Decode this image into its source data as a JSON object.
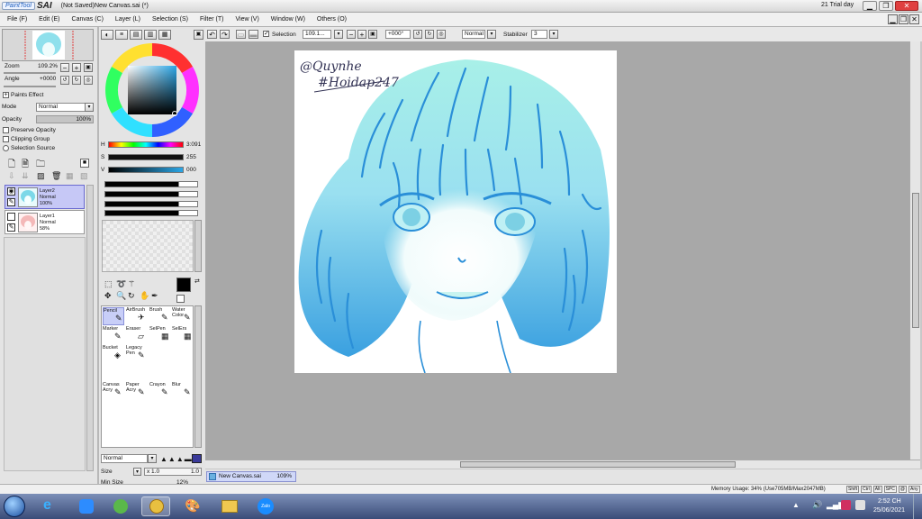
{
  "titlebar": {
    "logo_small": "PaintTool",
    "logo_big": "SAI",
    "title": "(Not Saved)New Canvas.sai (*)",
    "trial": "21 Trial day",
    "minimize": "▁",
    "restore": "❐",
    "close": "✕"
  },
  "menu": [
    "File (F)",
    "Edit (E)",
    "Canvas (C)",
    "Layer (L)",
    "Selection (S)",
    "Filter (T)",
    "View (V)",
    "Window (W)",
    "Others (O)"
  ],
  "toolbar": {
    "selection_label": "Selection",
    "zoom_value": "109.1...",
    "rotation_value": "+000°",
    "mode_value": "Normal",
    "stabilizer_label": "Stabilizer",
    "stabilizer_value": "3"
  },
  "navigator": {
    "zoom_label": "Zoom",
    "zoom_value": "109.2%",
    "angle_label": "Angle",
    "angle_value": "+0000"
  },
  "layer_props": {
    "paints_effect": "Paints Effect",
    "mode_label": "Mode",
    "mode_value": "Normal",
    "opacity_label": "Opacity",
    "opacity_value": "100%",
    "preserve_opacity": "Preserve Opacity",
    "clipping_group": "Clipping Group",
    "selection_source": "Selection Source"
  },
  "layers": [
    {
      "name": "Layer2",
      "mode": "Normal",
      "opacity": "100%",
      "selected": true
    },
    {
      "name": "Layer1",
      "mode": "Normal",
      "opacity": "58%",
      "selected": false
    }
  ],
  "color": {
    "h_label": "H",
    "h_value": "3:091",
    "s_label": "S",
    "s_value": "255",
    "v_label": "V",
    "v_value": "000",
    "current": "#000000"
  },
  "tools": [
    {
      "label": "Pencil",
      "label2": "",
      "icon": "✎"
    },
    {
      "label": "AirBrush",
      "label2": "",
      "icon": "✈"
    },
    {
      "label": "Brush",
      "label2": "",
      "icon": "✎"
    },
    {
      "label": "Water",
      "label2": "Color",
      "icon": "✎"
    },
    {
      "label": "Marker",
      "label2": "",
      "icon": "✎"
    },
    {
      "label": "Eraser",
      "label2": "",
      "icon": "▱"
    },
    {
      "label": "SelPen",
      "label2": "",
      "icon": "▦"
    },
    {
      "label": "SelErs",
      "label2": "",
      "icon": "▦"
    },
    {
      "label": "Bucket",
      "label2": "",
      "icon": "◈"
    },
    {
      "label": "Legacy",
      "label2": "Pen",
      "icon": "✎"
    },
    {
      "label": "Canvas",
      "label2": "Acry",
      "icon": "✎"
    },
    {
      "label": "Paper",
      "label2": "Acry",
      "icon": "✎"
    },
    {
      "label": "Crayon",
      "label2": "",
      "icon": "✎"
    },
    {
      "label": "Blur",
      "label2": "",
      "icon": "✎"
    }
  ],
  "brush": {
    "mode_value": "Normal",
    "size_label": "Size",
    "size_mult": "x 1.0",
    "size_value": "1.0",
    "min_size_label": "Min Size",
    "min_size_value": "12%"
  },
  "doc_tab": {
    "name": "New Canvas.sai",
    "zoom": "109%"
  },
  "status": {
    "memory": "Memory Usage: 34% (Use705MB/Max2047MB)",
    "keys": [
      "Shift",
      "Ctrl",
      "Alt",
      "SPC",
      "@",
      "Any"
    ]
  },
  "taskbar": {
    "time": "2:52 CH",
    "date": "25/06/2021",
    "zalo_label": "Zalo"
  },
  "artwork": {
    "signature_line1": "@Quynhe",
    "signature_line2": "#Hoidap247"
  }
}
